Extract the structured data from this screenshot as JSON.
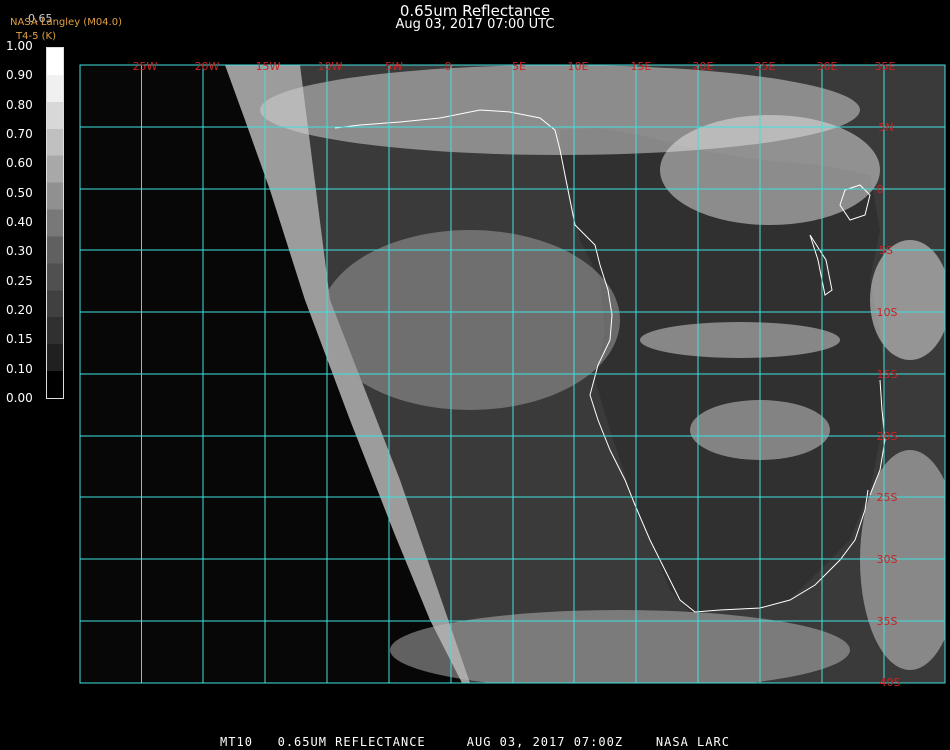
{
  "header": {
    "title": "0.65um Reflectance",
    "subtitle": "Aug 03, 2017 07:00 UTC",
    "logo_text": "NASA Langley (M04.0)",
    "logo_sub": "T4-5 (K)",
    "colorbar_top_label": "0.65"
  },
  "colorbar": {
    "ticks": [
      "1.00",
      "0.90",
      "0.80",
      "0.70",
      "0.60",
      "0.50",
      "0.40",
      "0.30",
      "0.25",
      "0.20",
      "0.15",
      "0.10",
      "0.00"
    ],
    "gradient": [
      "#ffffff",
      "#f0f0f0",
      "#d8d8d8",
      "#c0c0c0",
      "#a8a8a8",
      "#909090",
      "#787878",
      "#606060",
      "#505050",
      "#404040",
      "#303030",
      "#202020",
      "#000000"
    ]
  },
  "map": {
    "lon_labels": [
      "25W",
      "20W",
      "15W",
      "10W",
      "5W",
      "0",
      "5E",
      "10E",
      "15E",
      "20E",
      "25E",
      "30E",
      "35E"
    ],
    "lat_labels": [
      "5N",
      "0",
      "5S",
      "10S",
      "15S",
      "20S",
      "25S",
      "30S",
      "35S",
      "40S"
    ],
    "grid_color": "#40e0e0",
    "label_color": "#cc2222",
    "coast_color": "#ffffff"
  },
  "footer": {
    "text": "MT10   0.65UM REFLECTANCE     AUG 03, 2017 07:00Z    NASA LARC"
  }
}
